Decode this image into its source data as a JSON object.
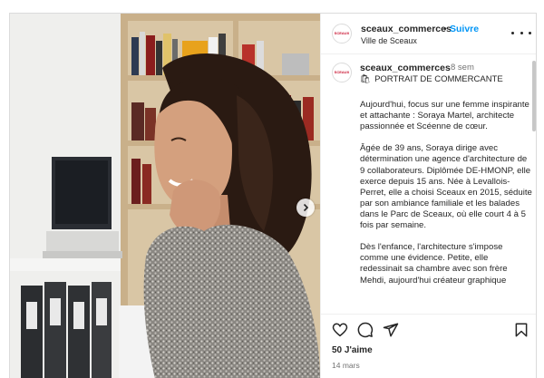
{
  "post": {
    "username": "sceaux_commerces",
    "separator": "•",
    "follow_label": "Suivre",
    "location": "Ville de Sceaux",
    "avatar_text": "SCEAUX",
    "more_icon": "more-horizontal-icon",
    "next_icon": "chevron-right-icon"
  },
  "caption": {
    "username": "sceaux_commerces",
    "time_ago": "8 sem",
    "title_emoji": "🛍",
    "title": "PORTRAIT DE COMMERCANTE",
    "paragraphs": [
      "Aujourd'hui, focus sur une femme inspirante et attachante : Soraya Martel, architecte passionnée et Scéenne de cœur.",
      "Âgée de 39 ans, Soraya dirige avec détermination une agence d'architecture de 9 collaborateurs. Diplômée DE-HMONP, elle exerce depuis 15 ans. Née à Levallois-Perret, elle a choisi Sceaux en 2015, séduite par son ambiance familiale et les balades dans le Parc de Sceaux, où elle court 4 à 5 fois par semaine.",
      "Dès l'enfance, l'architecture s'impose comme une évidence. Petite, elle redessinait sa chambre avec son frère Mehdi, aujourd'hui créateur graphique"
    ]
  },
  "actions": {
    "like_icon": "heart-icon",
    "comment_icon": "comment-icon",
    "share_icon": "send-icon",
    "save_icon": "bookmark-icon",
    "likes": "50 J'aime",
    "date": "14 mars"
  }
}
